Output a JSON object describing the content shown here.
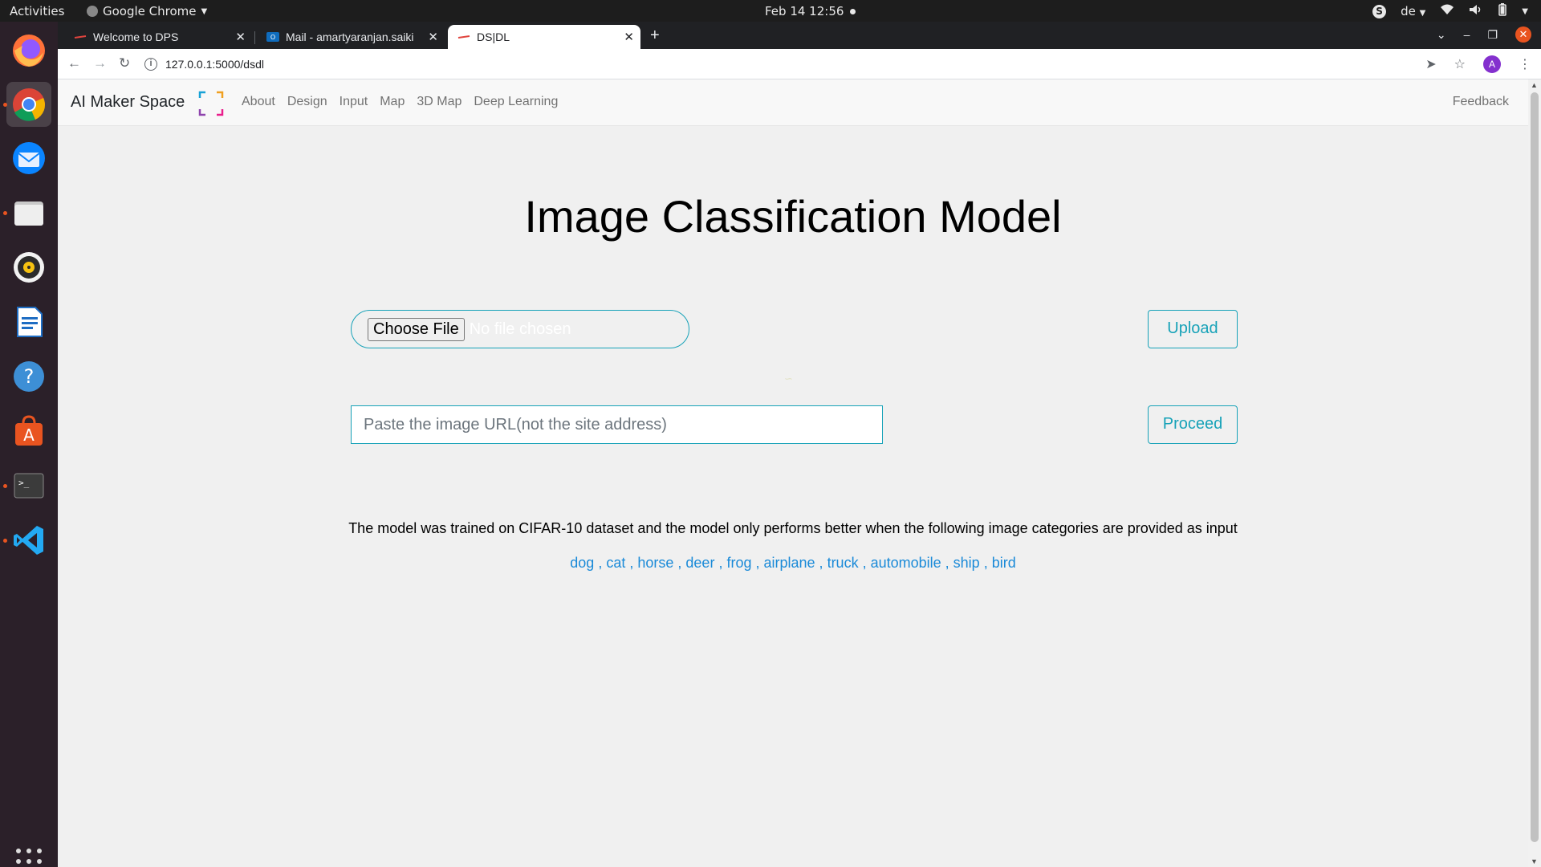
{
  "system": {
    "activities": "Activities",
    "app_name": "Google Chrome",
    "clock": "Feb 14  12:56",
    "keyboard_layout": "de"
  },
  "browser": {
    "tabs": [
      {
        "title": "Welcome to DPS",
        "active": false
      },
      {
        "title": "Mail - amartyaranjan.saiki",
        "active": false
      },
      {
        "title": "DS|DL",
        "active": true
      }
    ],
    "url": "127.0.0.1:5000/dsdl",
    "profile_initial": "A",
    "accent_close": "#e95420"
  },
  "navbar": {
    "brand": "AI Maker Space",
    "links": [
      "About",
      "Design",
      "Input",
      "Map",
      "3D Map",
      "Deep Learning"
    ],
    "feedback": "Feedback"
  },
  "main": {
    "title": "Image Classification Model",
    "file_button": "Choose File",
    "file_status": "No file chosen",
    "upload_button": "Upload",
    "url_placeholder": "Paste the image URL(not the site address)",
    "url_value": "",
    "proceed_button": "Proceed",
    "description": "The model was trained on CIFAR-10 dataset and the model only performs better when the following image categories are provided as input",
    "categories": [
      "dog",
      "cat",
      "horse",
      "deer",
      "frog",
      "airplane",
      "truck",
      "automobile",
      "ship",
      "bird"
    ],
    "accent_color": "#17a2b8",
    "link_color": "#1a8ad8"
  },
  "dock": {
    "icons": [
      "firefox-icon",
      "chrome-icon",
      "thunderbird-icon",
      "files-icon",
      "rhythmbox-icon",
      "writer-icon",
      "help-icon",
      "software-center-icon",
      "terminal-icon",
      "vscode-icon",
      "show-apps-icon"
    ]
  }
}
